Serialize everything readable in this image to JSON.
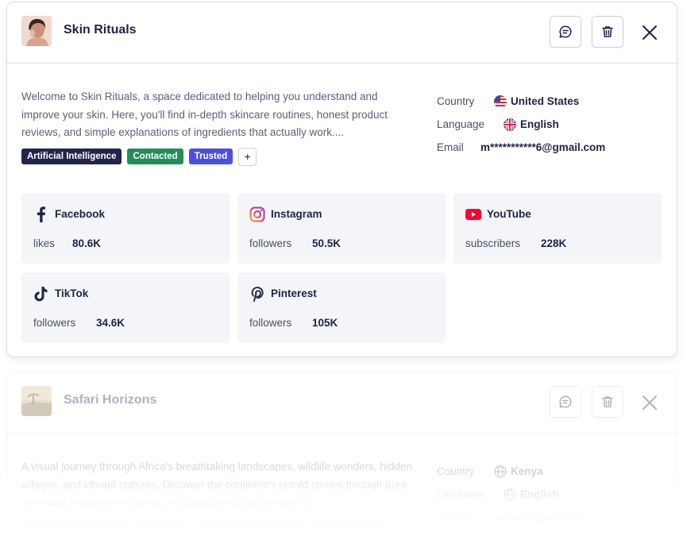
{
  "cards": [
    {
      "title": "Skin Rituals",
      "avatar": "woman-portrait-avatar",
      "description": "Welcome to Skin Rituals, a space dedicated to helping you understand and improve your skin. Here, you'll find in-depth skincare routines, honest product reviews, and simple explanations of ingredients that actually work....",
      "tags": [
        {
          "label": "Artificial Intelligence",
          "color": "#22254a"
        },
        {
          "label": "Contacted",
          "color": "#1f8f5a"
        },
        {
          "label": "Trusted",
          "color": "#4b4fe0"
        }
      ],
      "tag_add_label": "+",
      "meta": {
        "country_label": "Country",
        "country_value": "United States",
        "language_label": "Language",
        "language_value": "English",
        "email_label": "Email",
        "email_value": "m***********6@gmail.com"
      },
      "socials": [
        {
          "name": "Facebook",
          "icon": "facebook-icon",
          "metric_label": "likes",
          "metric_value": "80.6K"
        },
        {
          "name": "Instagram",
          "icon": "instagram-icon",
          "metric_label": "followers",
          "metric_value": "50.5K"
        },
        {
          "name": "YouTube",
          "icon": "youtube-icon",
          "metric_label": "subscribers",
          "metric_value": "228K"
        },
        {
          "name": "TikTok",
          "icon": "tiktok-icon",
          "metric_label": "followers",
          "metric_value": "34.6K"
        },
        {
          "name": "Pinterest",
          "icon": "pinterest-icon",
          "metric_label": "followers",
          "metric_value": "105K"
        }
      ]
    },
    {
      "title": "Safari Horizons",
      "avatar": "safari-landscape-avatar",
      "description": "A visual journey through Africa's breathtaking landscapes, wildlife wonders, hidden villages, and vibrant cultures. Discover the continent's untold stories through pure cinematic imagery—no words, no distractions, just Africa in it",
      "meta": {
        "country_label": "Country",
        "country_value": "Kenya",
        "language_label": "Language",
        "language_value": "English",
        "website_label": "Website",
        "website_value": "safarihorizons.com"
      }
    }
  ],
  "colors": {
    "border": "#dcdde3",
    "text_primary": "#1f2344",
    "text_secondary": "#5c6079",
    "tile_bg": "#f4f5f8",
    "youtube_red": "#ff0033",
    "pinterest_ink": "#2b2d52"
  }
}
